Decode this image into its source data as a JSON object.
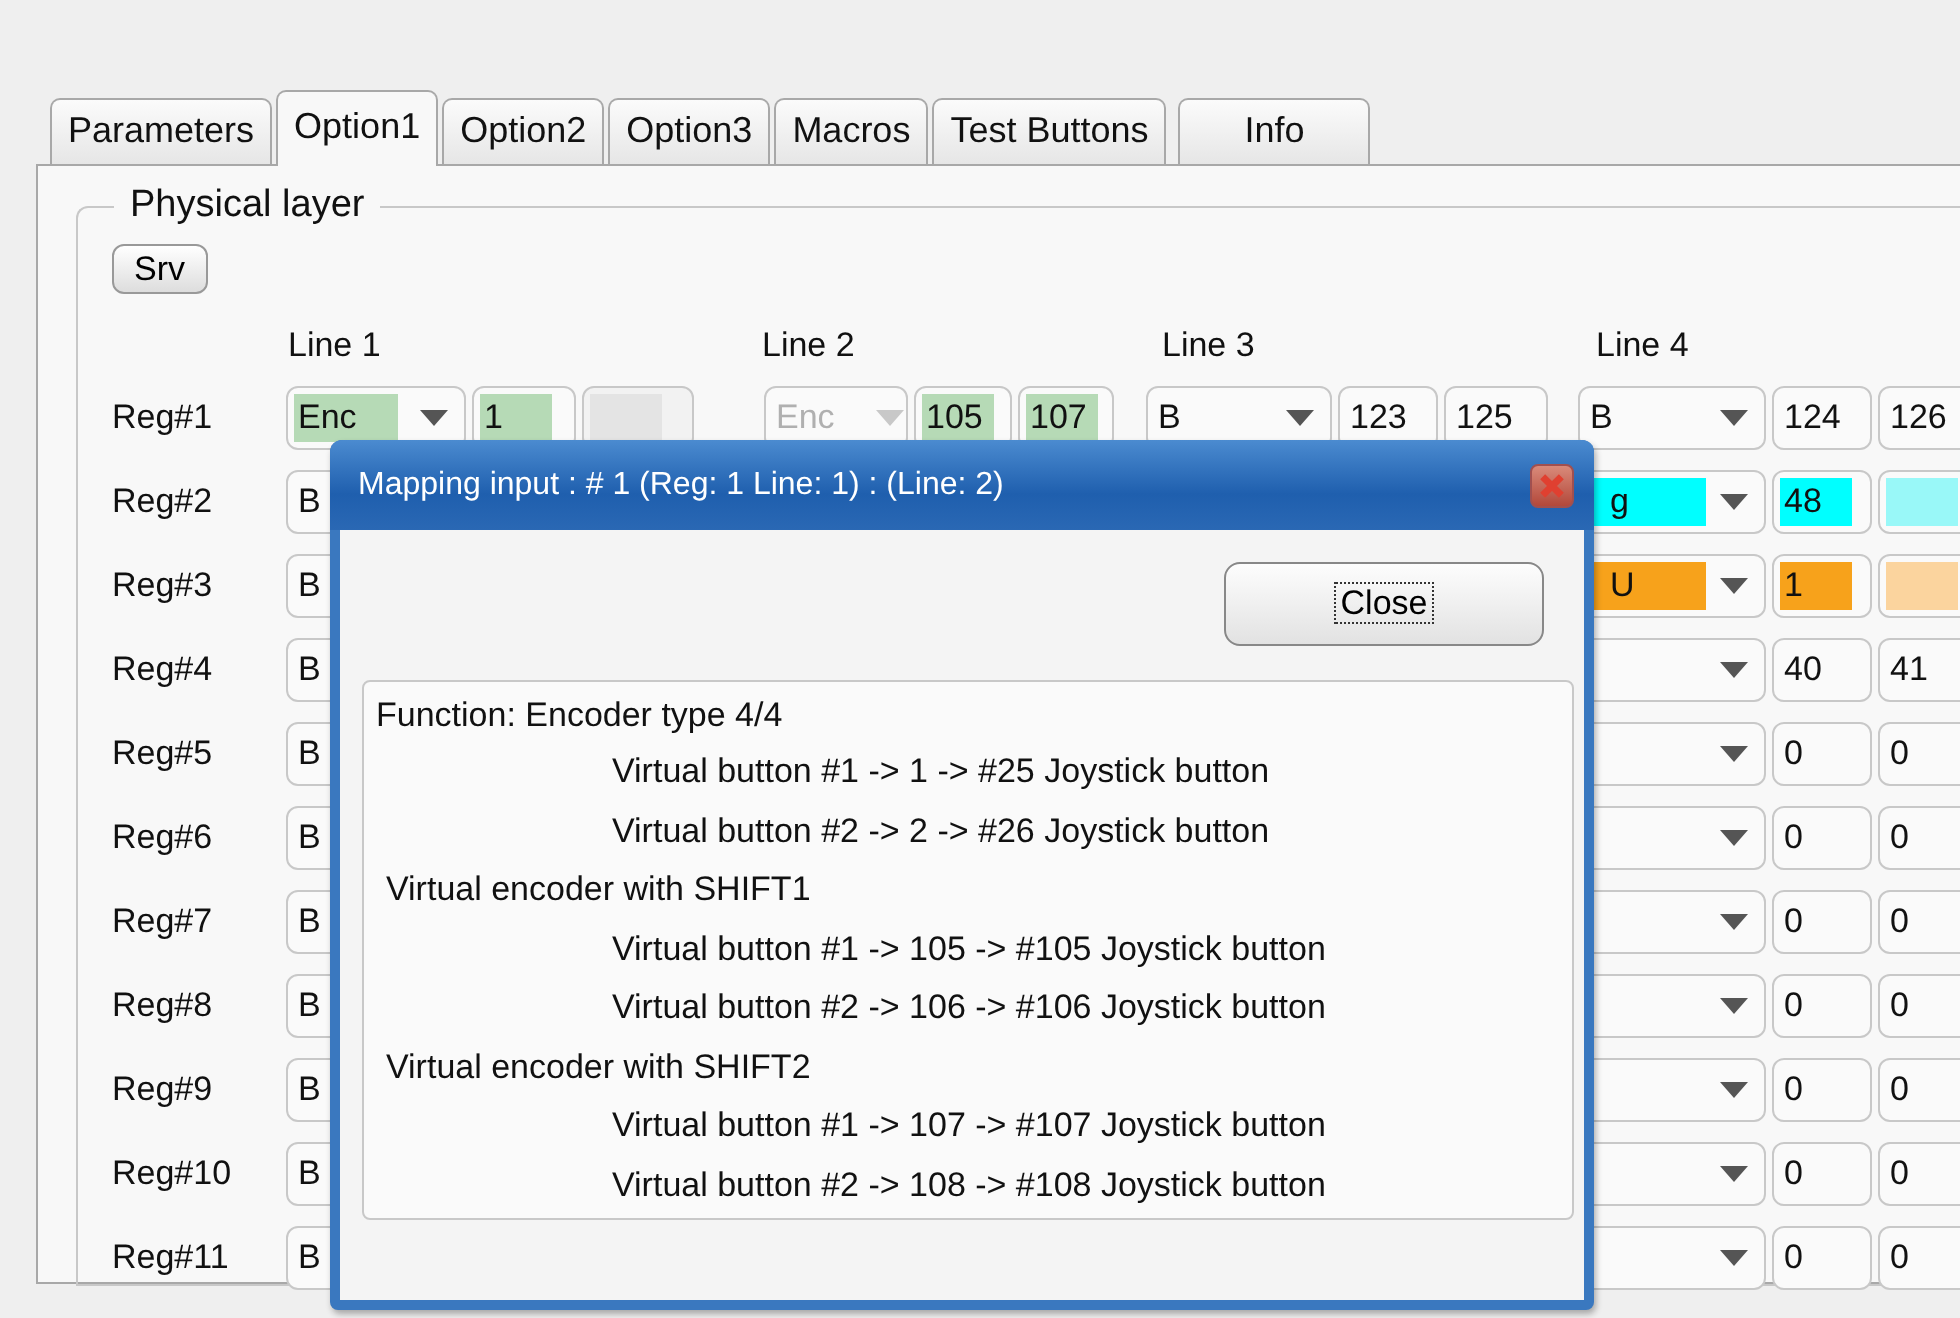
{
  "tabs": [
    {
      "label": "Parameters",
      "selected": false
    },
    {
      "label": "Option1",
      "selected": true
    },
    {
      "label": "Option2",
      "selected": false
    },
    {
      "label": "Option3",
      "selected": false
    },
    {
      "label": "Macros",
      "selected": false
    },
    {
      "label": "Test Buttons",
      "selected": false
    },
    {
      "label": "Info",
      "selected": false
    }
  ],
  "group": {
    "title": "Physical layer",
    "srv_button": "Srv",
    "line_headers": [
      "Line 1",
      "Line 2",
      "Line 3",
      "Line 4"
    ],
    "rows": [
      {
        "label": "Reg#1",
        "cells": [
          {
            "kind": "combo",
            "value": "Enc",
            "color": "#b6dab6",
            "disabled": false
          },
          {
            "kind": "field",
            "value": "1",
            "color": "#b6dab6",
            "disabled": false
          },
          {
            "kind": "field",
            "disabled": true
          },
          {
            "kind": "combo",
            "value": "Enc",
            "disabled": true
          },
          {
            "kind": "field",
            "value": "105",
            "color": "#b6dab6",
            "disabled": false
          },
          {
            "kind": "field",
            "value": "107",
            "color": "#b6dab6",
            "disabled": false
          },
          {
            "kind": "combo",
            "value": "B",
            "disabled": false
          },
          {
            "kind": "field",
            "value": "123",
            "disabled": false
          },
          {
            "kind": "field",
            "value": "125",
            "disabled": false
          },
          {
            "kind": "combo",
            "value": "B",
            "disabled": false
          },
          {
            "kind": "field",
            "value": "124",
            "disabled": false
          },
          {
            "kind": "field",
            "value": "126",
            "disabled": false
          }
        ]
      },
      {
        "label": "Reg#2",
        "cells": [
          {
            "kind": "combo",
            "value": "B",
            "disabled": false
          },
          {
            "kind": "combo_tail",
            "value": "g",
            "color": "#00ffff",
            "disabled": false
          },
          {
            "kind": "field",
            "value": "48",
            "color": "#00ffff",
            "disabled": false
          },
          {
            "kind": "field",
            "color": "#99f8f8",
            "disabled": false
          }
        ]
      },
      {
        "label": "Reg#3",
        "cells": [
          {
            "kind": "combo",
            "value": "B",
            "disabled": false
          },
          {
            "kind": "combo_tail",
            "value": "U",
            "color": "#f7a21b",
            "disabled": false
          },
          {
            "kind": "field",
            "value": "1",
            "color": "#f7a21b",
            "disabled": false
          },
          {
            "kind": "field",
            "color": "#fbd49e",
            "disabled": false
          }
        ]
      },
      {
        "label": "Reg#4",
        "cells": [
          {
            "kind": "combo",
            "value": "B",
            "disabled": false
          },
          {
            "kind": "combo_tail",
            "disabled": false
          },
          {
            "kind": "field",
            "value": "40",
            "disabled": false
          },
          {
            "kind": "field",
            "value": "41",
            "disabled": false
          }
        ]
      },
      {
        "label": "Reg#5",
        "cells": [
          {
            "kind": "combo",
            "value": "B",
            "disabled": false
          },
          {
            "kind": "combo_tail",
            "disabled": false
          },
          {
            "kind": "field",
            "value": "0",
            "disabled": false
          },
          {
            "kind": "field",
            "value": "0",
            "disabled": false
          }
        ]
      },
      {
        "label": "Reg#6",
        "cells": [
          {
            "kind": "combo",
            "value": "B",
            "disabled": false
          },
          {
            "kind": "combo_tail",
            "disabled": false
          },
          {
            "kind": "field",
            "value": "0",
            "disabled": false
          },
          {
            "kind": "field",
            "value": "0",
            "disabled": false
          }
        ]
      },
      {
        "label": "Reg#7",
        "cells": [
          {
            "kind": "combo",
            "value": "B",
            "disabled": false
          },
          {
            "kind": "combo_tail",
            "disabled": false
          },
          {
            "kind": "field",
            "value": "0",
            "disabled": false
          },
          {
            "kind": "field",
            "value": "0",
            "disabled": false
          }
        ]
      },
      {
        "label": "Reg#8",
        "cells": [
          {
            "kind": "combo",
            "value": "B",
            "disabled": false
          },
          {
            "kind": "combo_tail",
            "disabled": false
          },
          {
            "kind": "field",
            "value": "0",
            "disabled": false
          },
          {
            "kind": "field",
            "value": "0",
            "disabled": false
          }
        ]
      },
      {
        "label": "Reg#9",
        "cells": [
          {
            "kind": "combo",
            "value": "B",
            "disabled": false
          },
          {
            "kind": "combo_tail",
            "disabled": false
          },
          {
            "kind": "field",
            "value": "0",
            "disabled": false
          },
          {
            "kind": "field",
            "value": "0",
            "disabled": false
          }
        ]
      },
      {
        "label": "Reg#10",
        "cells": [
          {
            "kind": "combo",
            "value": "B",
            "disabled": false
          },
          {
            "kind": "combo_tail",
            "disabled": false
          },
          {
            "kind": "field",
            "value": "0",
            "disabled": false
          },
          {
            "kind": "field",
            "value": "0",
            "disabled": false
          }
        ]
      },
      {
        "label": "Reg#11",
        "cells": [
          {
            "kind": "combo",
            "value": "B",
            "disabled": false
          },
          {
            "kind": "combo_tail",
            "disabled": false
          },
          {
            "kind": "field",
            "value": "0",
            "disabled": false
          },
          {
            "kind": "field",
            "value": "0",
            "disabled": false
          }
        ]
      }
    ]
  },
  "dialog": {
    "title": "Mapping input : #  1 (Reg: 1 Line: 1) : (Line: 2)",
    "close_button": "Close",
    "sections": [
      {
        "heading": "Function:  Encoder type 4/4",
        "items": [
          "Virtual button #1 -> 1 ->  #25 Joystick button",
          "Virtual button #2 -> 2 ->  #26 Joystick button"
        ]
      },
      {
        "heading": "Virtual encoder  with SHIFT1",
        "items": [
          "Virtual button #1 -> 105 ->  #105 Joystick button",
          "Virtual button #2 -> 106 ->  #106 Joystick button"
        ]
      },
      {
        "heading": "Virtual encoder  with SHIFT2",
        "items": [
          "Virtual button #1 -> 107 ->  #107 Joystick button",
          "Virtual button #2 -> 108 ->  #108 Joystick button"
        ]
      }
    ]
  }
}
